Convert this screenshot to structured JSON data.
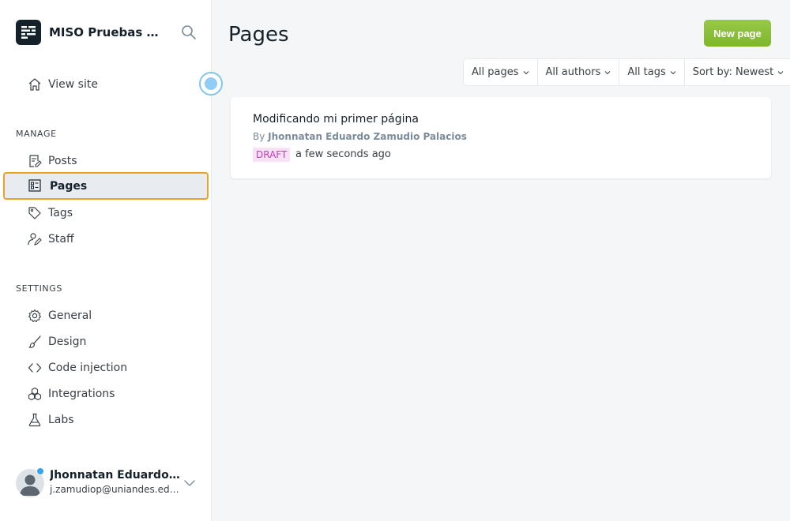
{
  "brand": {
    "name": "MISO Pruebas Aut..."
  },
  "nav": {
    "view_site": "View site",
    "manage_label": "MANAGE",
    "manage_items": [
      {
        "label": "Posts",
        "icon": "posts-icon"
      },
      {
        "label": "Pages",
        "icon": "pages-icon",
        "active": true
      },
      {
        "label": "Tags",
        "icon": "tag-icon"
      },
      {
        "label": "Staff",
        "icon": "staff-icon"
      }
    ],
    "settings_label": "SETTINGS",
    "settings_items": [
      {
        "label": "General",
        "icon": "gear-icon"
      },
      {
        "label": "Design",
        "icon": "brush-icon"
      },
      {
        "label": "Code injection",
        "icon": "code-icon"
      },
      {
        "label": "Integrations",
        "icon": "integrations-icon"
      },
      {
        "label": "Labs",
        "icon": "flask-icon"
      }
    ]
  },
  "user": {
    "name": "Jhonnatan Eduardo Za...",
    "email": "j.zamudiop@uniandes.edu..."
  },
  "main": {
    "title": "Pages",
    "new_button": "New page",
    "filters": [
      "All pages",
      "All authors",
      "All tags",
      "Sort by: Newest"
    ]
  },
  "pages_list": [
    {
      "title": "Modificando mi primer página",
      "by_prefix": "By",
      "author": "Jhonnatan Eduardo Zamudio Palacios",
      "status": "DRAFT",
      "time": "a few seconds ago"
    }
  ],
  "colors": {
    "accent_green": "#8ec23f",
    "active_border": "#e8a32a",
    "draft_badge_bg": "#f8e0f6",
    "draft_badge_text": "#c043b3",
    "notification_dot": "#30a5f0"
  }
}
